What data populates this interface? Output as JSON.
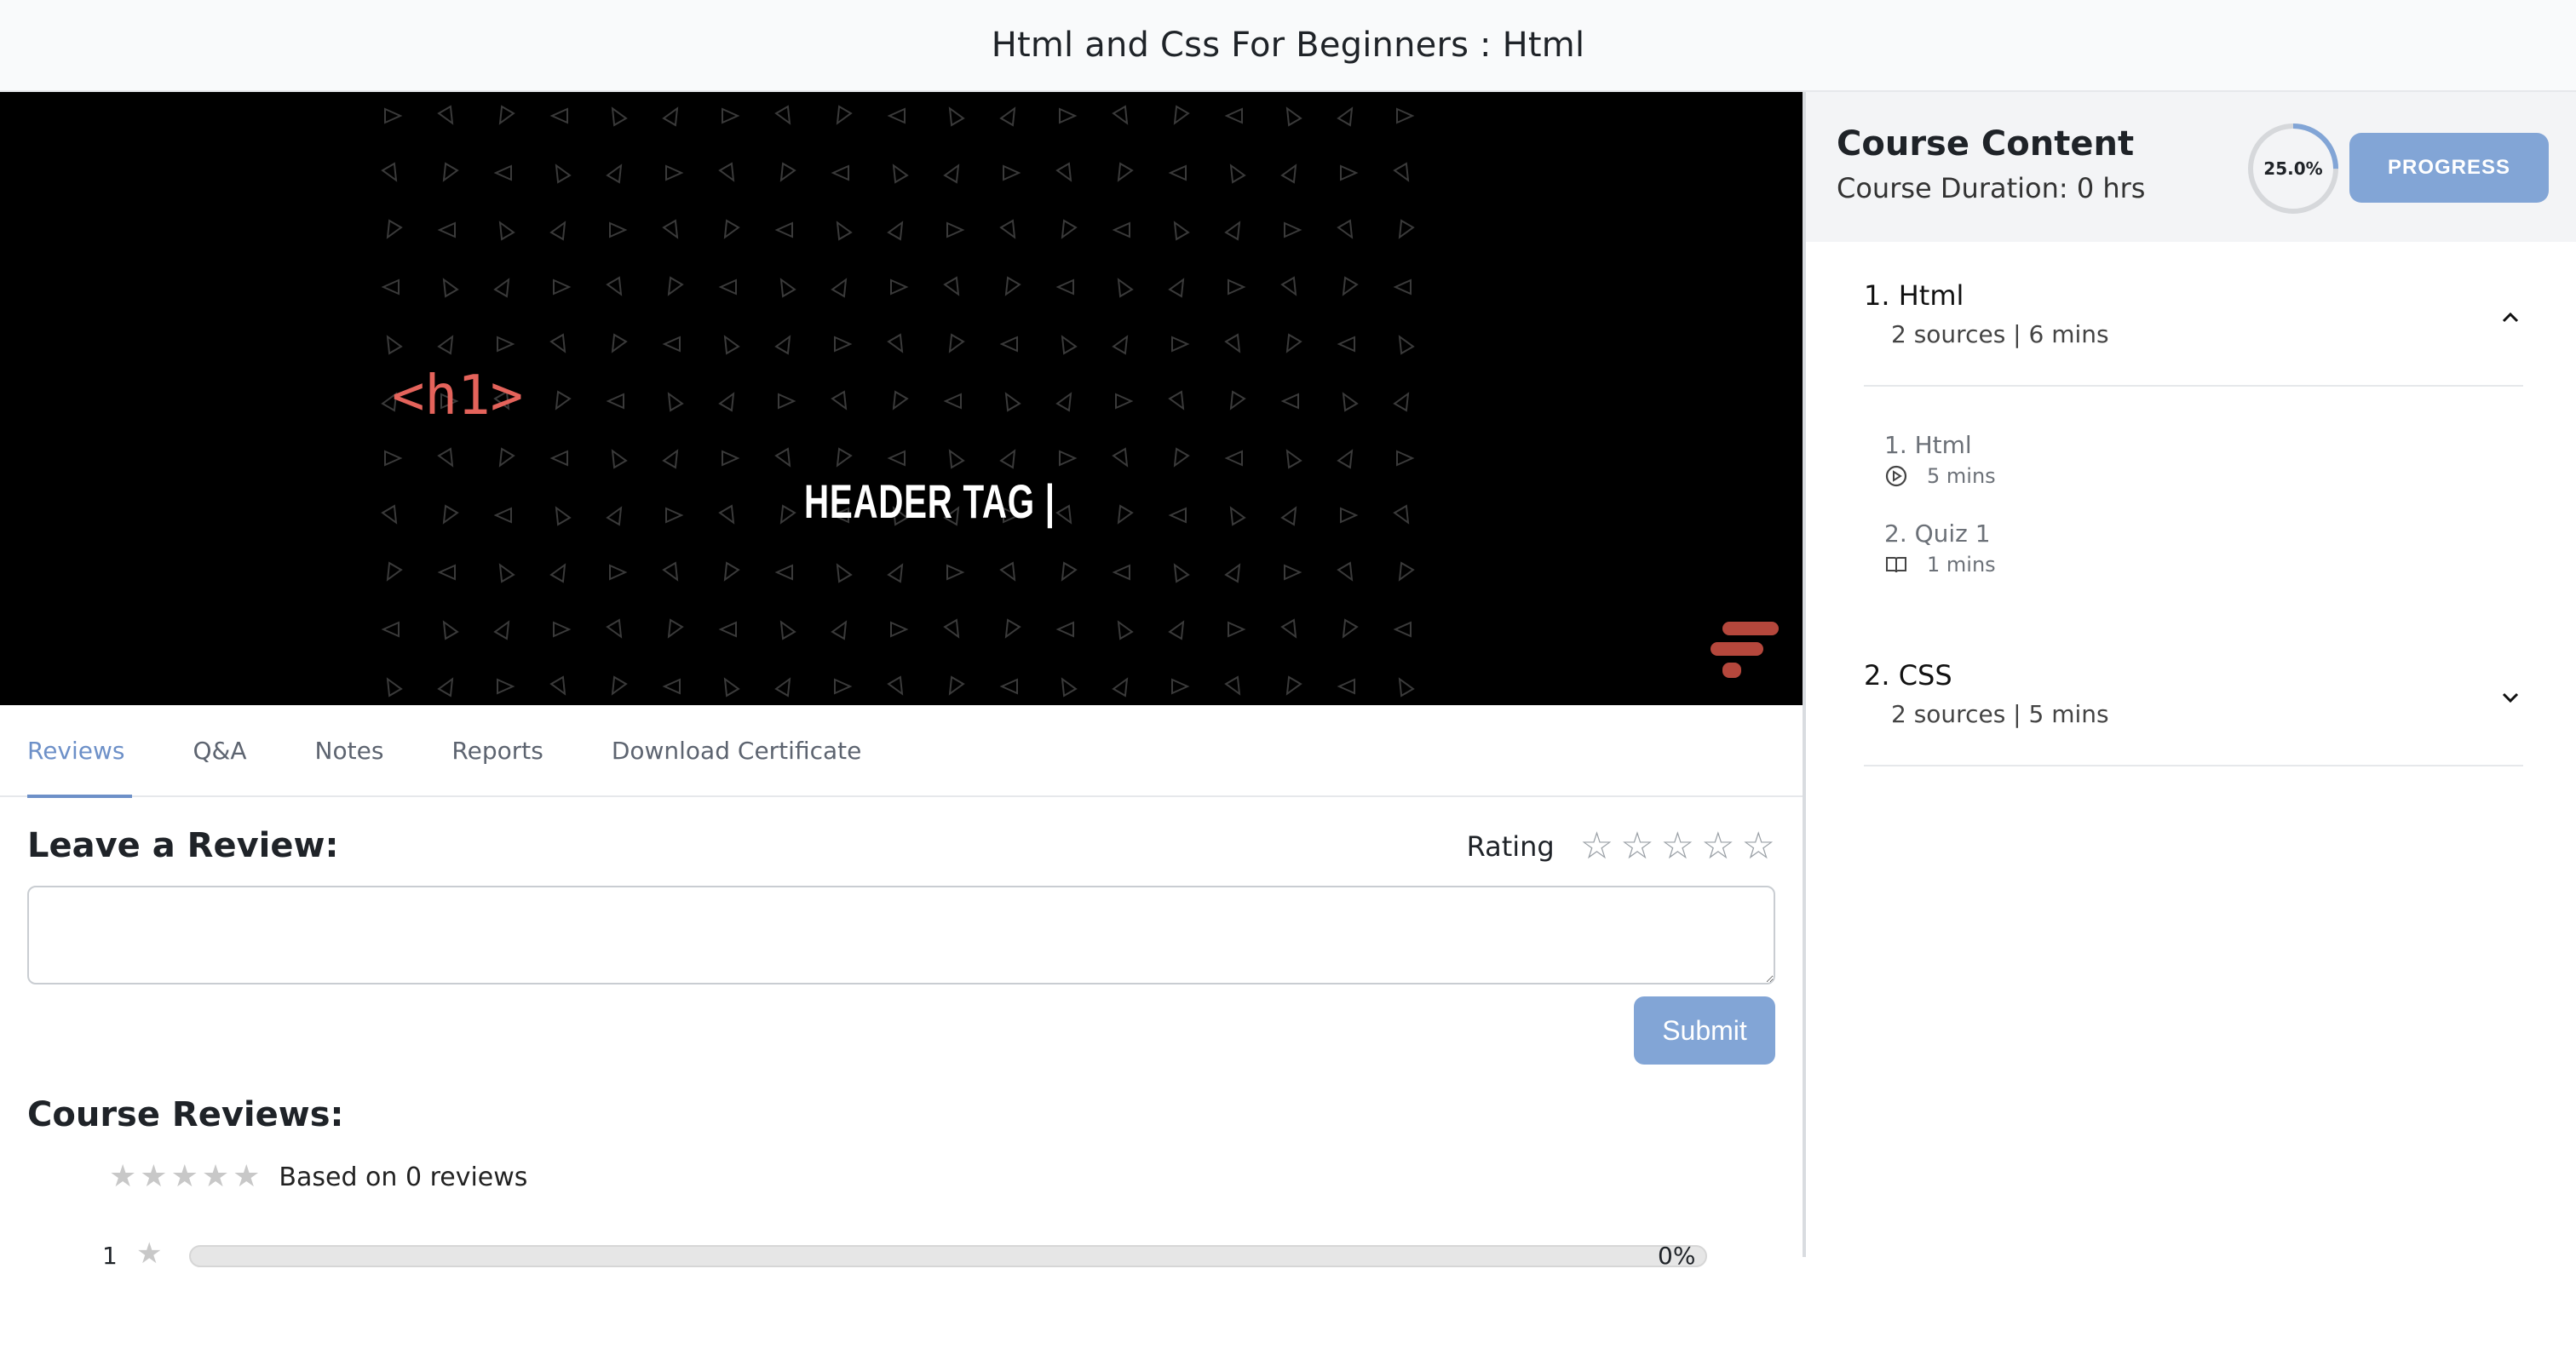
{
  "page": {
    "title": "Html and Css For Beginners : Html"
  },
  "video": {
    "code_label": "<h1>",
    "caption": "HEADER TAG |"
  },
  "tabs": [
    {
      "label": "Reviews",
      "active": true
    },
    {
      "label": "Q&A"
    },
    {
      "label": "Notes"
    },
    {
      "label": "Reports"
    },
    {
      "label": "Download Certificate"
    }
  ],
  "review_form": {
    "heading": "Leave a Review:",
    "rating_label": "Rating",
    "rating_stars": 5,
    "input_value": "",
    "submit_label": "Submit"
  },
  "course_reviews": {
    "heading": "Course Reviews:",
    "average_stars": 0,
    "based_on": "Based on 0 reviews",
    "histogram": [
      {
        "rating": "1",
        "percent_label": "0%",
        "fraction": 0
      }
    ]
  },
  "sidebar": {
    "title": "Course Content",
    "duration": "Course Duration: 0 hrs",
    "progress_label": "25.0%",
    "progress_fraction": 0.25,
    "progress_button": "PROGRESS",
    "sections": [
      {
        "title": "1. Html",
        "meta": "2 sources | 6 mins",
        "expanded": true,
        "lessons": [
          {
            "title": "1. Html",
            "icon": "play-circle-icon",
            "duration": "5 mins"
          },
          {
            "title": "2. Quiz 1",
            "icon": "book-icon",
            "duration": "1 mins"
          }
        ]
      },
      {
        "title": "2. CSS",
        "meta": "2 sources | 5 mins",
        "expanded": false,
        "lessons": []
      }
    ]
  },
  "colors": {
    "accent": "#82a5d6",
    "tab_active": "#6d90c8",
    "video_bg": "#000000",
    "code_red": "#e4635b"
  }
}
